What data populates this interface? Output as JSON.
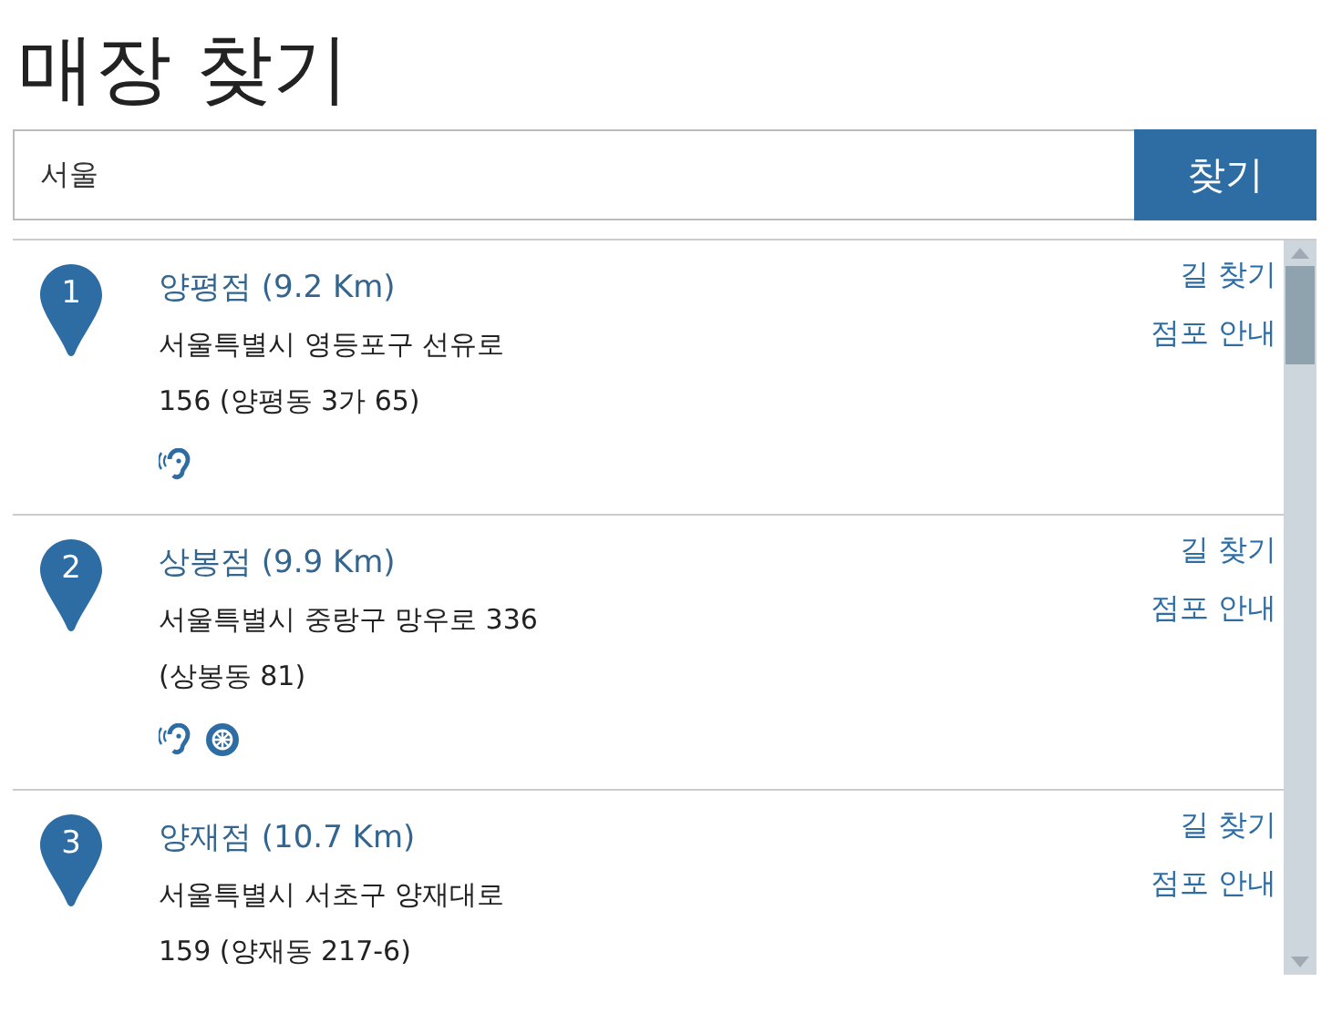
{
  "title": "매장 찾기",
  "search": {
    "value": "서울",
    "button": "찾기"
  },
  "stores": [
    {
      "number": "1",
      "name": "양평점 (9.2 Km)",
      "address_lines": [
        "서울특별시 영등포구 선유로",
        "156 (양평동 3가 65)"
      ],
      "facilities": [
        {
          "kind": "hearing"
        }
      ],
      "links": [
        "길 찾기",
        "점포 안내"
      ]
    },
    {
      "number": "2",
      "name": "상봉점 (9.9 Km)",
      "address_lines": [
        "서울특별시 중랑구 망우로 336",
        "(상봉동 81)"
      ],
      "facilities": [
        {
          "kind": "hearing"
        },
        {
          "kind": "wheel"
        }
      ],
      "links": [
        "길 찾기",
        "점포 안내"
      ]
    },
    {
      "number": "3",
      "name": "양재점 (10.7 Km)",
      "address_lines": [
        "서울특별시 서초구 양재대로",
        "159 (양재동 217-6)"
      ],
      "links": [
        "길 찾기",
        "점포 안내"
      ]
    }
  ]
}
